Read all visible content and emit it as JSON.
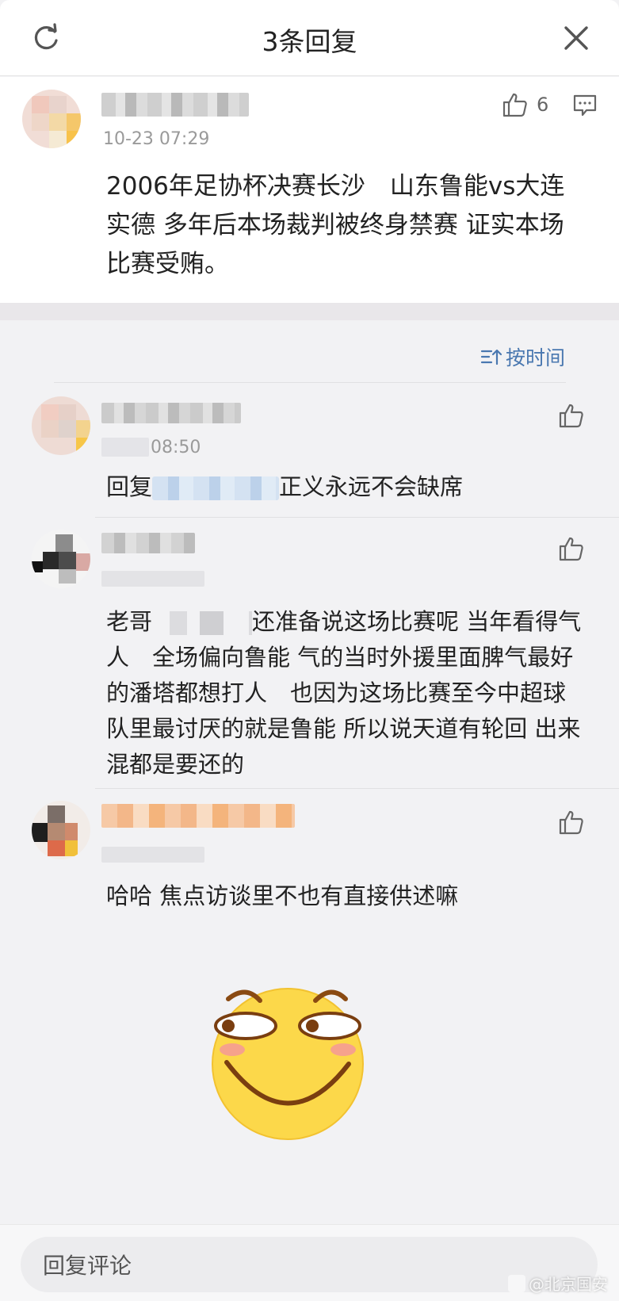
{
  "header": {
    "title": "3条回复"
  },
  "main_comment": {
    "time": "10-23 07:29",
    "like_count": "6",
    "text": "2006年足协杯决赛长沙　山东鲁能vs大连实德 多年后本场裁判被终身禁赛 证实本场比赛受贿。"
  },
  "sort": {
    "label": "按时间"
  },
  "replies": [
    {
      "time": "08:50",
      "prefix": "回复",
      "text": "正义永远不会缺席"
    },
    {
      "time": "",
      "prefix": "老哥",
      "text": "还准备说这场比赛呢 当年看得气人　全场偏向鲁能 气的当时外援里面脾气最好的潘塔都想打人　也因为这场比赛至今中超球队里最讨厌的就是鲁能 所以说天道有轮回 出来混都是要还的"
    },
    {
      "time": "",
      "prefix": "",
      "text": "哈哈 焦点访谈里不也有直接供述嘛"
    }
  ],
  "footer": {
    "placeholder": "回复评论"
  },
  "watermark": {
    "text": "@北京国安"
  },
  "colors": {
    "accent": "#4a78b0",
    "emoji_face": "#fcd84a",
    "background": "#f2f2f4"
  }
}
